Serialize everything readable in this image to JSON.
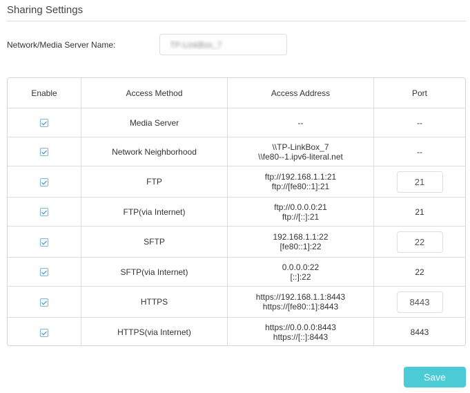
{
  "section_title": "Sharing Settings",
  "server": {
    "label": "Network/Media Server Name:",
    "value": "TP-LinkBox_7"
  },
  "table": {
    "headers": [
      "Enable",
      "Access Method",
      "Access Address",
      "Port"
    ],
    "rows": [
      {
        "enabled": true,
        "method": "Media Server",
        "address": [
          "--"
        ],
        "port": "--"
      },
      {
        "enabled": true,
        "method": "Network Neighborhood",
        "address": [
          "\\\\TP-LinkBox_7",
          "\\\\fe80--1.ipv6-literal.net"
        ],
        "port": "--"
      },
      {
        "enabled": true,
        "method": "FTP",
        "address": [
          "ftp://192.168.1.1:21",
          "ftp://[fe80::1]:21"
        ],
        "port_input": "21"
      },
      {
        "enabled": true,
        "method": "FTP(via Internet)",
        "address": [
          "ftp://0.0.0.0:21",
          "ftp://[::]:21"
        ],
        "port": "21"
      },
      {
        "enabled": true,
        "method": "SFTP",
        "address": [
          "192.168.1.1:22",
          "[fe80::1]:22"
        ],
        "port_input": "22"
      },
      {
        "enabled": true,
        "method": "SFTP(via Internet)",
        "address": [
          "0.0.0.0:22",
          "[::]:22"
        ],
        "port": "22"
      },
      {
        "enabled": true,
        "method": "HTTPS",
        "address": [
          "https://192.168.1.1:8443",
          "https://[fe80::1]:8443"
        ],
        "port_input": "8443"
      },
      {
        "enabled": true,
        "method": "HTTPS(via Internet)",
        "address": [
          "https://0.0.0.0:8443",
          "https://[::]:8443"
        ],
        "port": "8443"
      }
    ]
  },
  "save_label": "Save",
  "colors": {
    "accent": "#4acbd6",
    "checkbox_border": "#7fb7d9",
    "border": "#dcdcdc"
  },
  "icons": {
    "checkbox": "checkbox-checked-icon"
  }
}
